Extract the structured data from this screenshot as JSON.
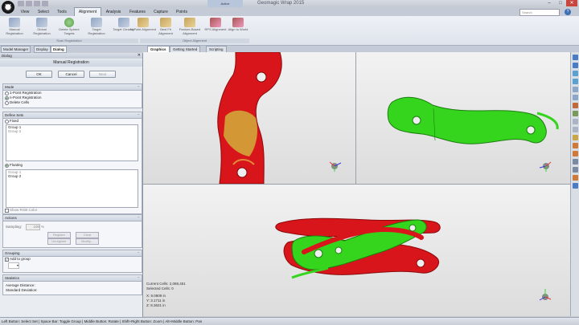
{
  "window": {
    "title": "Geomagic Wrap 2015",
    "context_tab": "Active",
    "controls": [
      "–",
      "□",
      "✕"
    ]
  },
  "ribbon_tabs": [
    "View",
    "Select",
    "Tools",
    "Alignment",
    "Analysis",
    "Features",
    "Capture",
    "Points"
  ],
  "active_ribbon_tab": "Alignment",
  "search": {
    "placeholder": "Search"
  },
  "ribbon": {
    "scan_registration": {
      "label": "Scan Registration",
      "buttons": [
        "Manual Registration",
        "Global Registration",
        "Delete Sphere Targets",
        "Target Registration",
        "Target Cleanup"
      ]
    },
    "object_alignment": {
      "label": "Object Alignment",
      "buttons": [
        "N-Point Alignment",
        "Best Fit Alignment",
        "Feature-Based Alignment",
        "RPS Alignment",
        "Align to World"
      ]
    }
  },
  "dock_tabs": [
    "Model Manager",
    "Display",
    "Dialog"
  ],
  "active_dock_tab": "Dialog",
  "dialog": {
    "header": "Dialog",
    "title": "Manual Registration",
    "ok": "OK",
    "cancel": "Cancel",
    "next": "Next",
    "mode": {
      "label": "Mode",
      "options": [
        "1-Point Registration",
        "n-Point Registration",
        "Delete Cells"
      ],
      "selected": "n-Point Registration"
    },
    "define_sets": {
      "label": "Define Sets",
      "fixed_label": "Fixed",
      "fixed_items": [
        "Group 1",
        "Group 2"
      ],
      "floating_label": "Floating",
      "floating_items": [
        "Group 1",
        "Group 2"
      ],
      "show_rgb": "Show RGB Color"
    },
    "actions": {
      "label": "Actions",
      "sampling_label": "Sampling:",
      "sampling_value": "100",
      "sampling_unit": "%",
      "register": "Register",
      "clear": "Clear",
      "unregister": "Unregister",
      "modify": "Modify..."
    },
    "grouping": {
      "label": "Grouping",
      "add_to_group": "Add to group",
      "add_to_group_checked": true
    },
    "statistics": {
      "label": "Statistics",
      "average_distance": "Average Distance:",
      "standard_deviation": "Standard Deviation:"
    }
  },
  "view_tabs": [
    "Graphics",
    "Getting Started",
    "Scripting"
  ],
  "active_view_tab": "Graphics",
  "viewport_readout": {
    "current_cells": "Current Cells: 2,088,451",
    "selected_cells": "Selected Cells: 0",
    "x": "X:  9.0909 in",
    "y": "Y:  3.1711 in",
    "z": "Z:  8.3621 in"
  },
  "colors": {
    "fixed_part": "#d8151a",
    "floating_part": "#35d51d",
    "highlight": "#d4a53a",
    "close_button": "#c8463e"
  },
  "statusbar": "Left Button: Select Set | Space Bar: Toggle Group | Middle Button: Rotate | Shift+Right Button: Zoom | Alt+Middle Button: Pan"
}
